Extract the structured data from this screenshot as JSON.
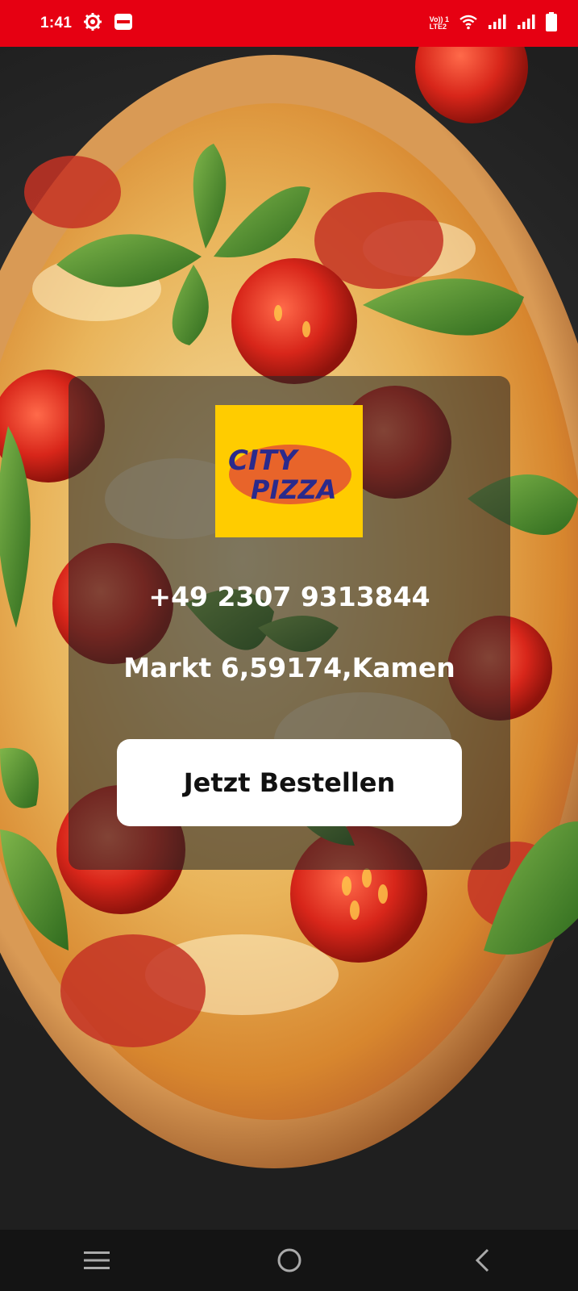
{
  "status_bar": {
    "time": "1:41",
    "network_label_top": "Vo)) 1",
    "network_label_bottom": "LTE2",
    "background_color": "#e60012",
    "icons": [
      "settings-gear-icon",
      "paytm-app-icon",
      "volte-icon",
      "wifi-icon",
      "signal-strength-icon",
      "signal-strength-icon",
      "battery-icon"
    ]
  },
  "background": {
    "image": "pizza-photo"
  },
  "card": {
    "logo": {
      "line1": "CITY",
      "line2": "PIZZA",
      "background_color": "#ffcc00",
      "oval_color": "#e8642a",
      "text_color": "#2a2a8c"
    },
    "phone": "+49 2307 9313844",
    "address": "Markt 6,59174,Kamen",
    "order_button_label": "Jetzt Bestellen"
  },
  "nav_bar": {
    "buttons": [
      "menu-icon",
      "home-icon",
      "back-icon"
    ]
  }
}
